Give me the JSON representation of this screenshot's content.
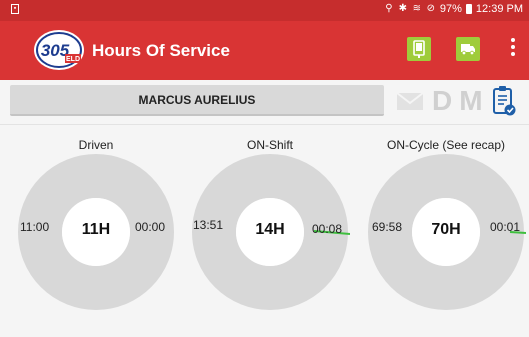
{
  "status_bar": {
    "battery": "97%",
    "time": "12:39 PM",
    "icons": [
      "location-icon",
      "bluetooth-icon",
      "wifi-icon",
      "do-not-disturb-icon",
      "battery-icon"
    ]
  },
  "app_bar": {
    "logo_number": "305",
    "logo_suffix": "ELD",
    "title": "Hours Of Service",
    "accent_color": "#d93434",
    "button_color": "#9fcc3b",
    "actions": [
      "phone-device-icon",
      "truck-arrow-icon",
      "more-vert-icon"
    ]
  },
  "driver": {
    "name": "MARCUS AURELIUS"
  },
  "modes": {
    "letters": [
      "D",
      "M"
    ],
    "icons": [
      "envelope-icon",
      "clipboard-check-icon"
    ]
  },
  "gauges": [
    {
      "title": "Driven",
      "center": "11H",
      "left": "11:00",
      "right": "00:00",
      "used_fraction": 0.0
    },
    {
      "title": "ON-Shift",
      "center": "14H",
      "left": "13:51",
      "right": "00:08",
      "used_fraction": 0.01
    },
    {
      "title": "ON-Cycle (See recap)",
      "center": "70H",
      "left": "69:58",
      "right": "00:01",
      "used_fraction": 0.0003
    }
  ]
}
